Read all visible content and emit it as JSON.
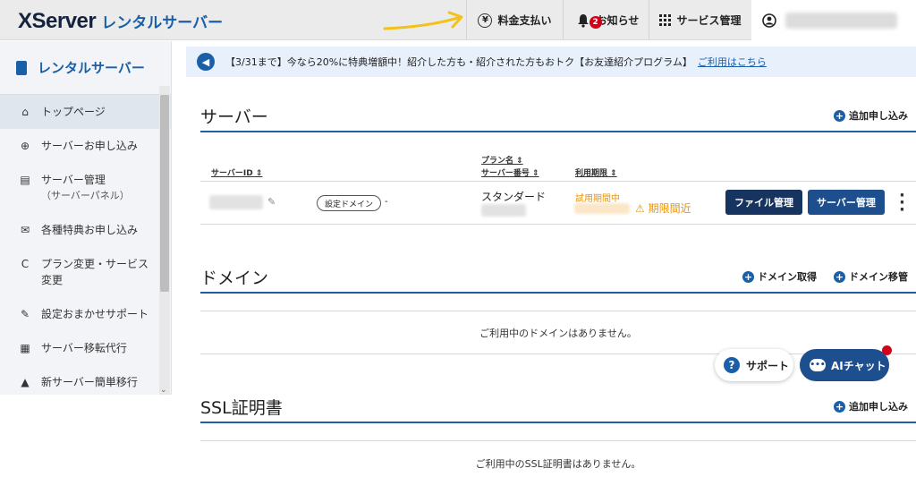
{
  "header": {
    "logo_main": "XServer",
    "logo_sub": "レンタルサーバー",
    "billing_label": "料金支払い",
    "billing_icon": "¥",
    "notifications_label": "お知らせ",
    "notifications_count": "2",
    "services_label": "サービス管理",
    "services_icon": "grid-icon"
  },
  "sidebar": {
    "title": "レンタルサーバー",
    "items": [
      {
        "label": "トップページ",
        "icon": "⌂"
      },
      {
        "label": "サーバーお申し込み",
        "icon": "⊕"
      },
      {
        "label": "サーバー管理",
        "sub": "（サーバーパネル）",
        "icon": "▤"
      },
      {
        "label": "各種特典お申し込み",
        "icon": "✉"
      },
      {
        "label": "プラン変更・サービス",
        "sub": "変更",
        "icon": "C"
      },
      {
        "label": "設定おまかせサポート",
        "icon": "✎"
      },
      {
        "label": "サーバー移転代行",
        "icon": "▦"
      },
      {
        "label": "新サーバー簡単移行",
        "icon": "▲"
      }
    ]
  },
  "banner": {
    "text": "【3/31まで】今なら20%に特典増額中！紹介した方も・紹介された方もおトク【お友達紹介プログラム】",
    "link": "ご利用はこちら"
  },
  "server_section": {
    "title": "サーバー",
    "add_label": "追加申し込み",
    "col_server_id": "サーバーID",
    "col_plan_name": "プラン名",
    "col_server_no": "サーバー番号",
    "col_period": "利用期限",
    "domain_tag": "設定ドメイン",
    "domain_value": "-",
    "plan": "スタンダード",
    "trial_status": "試用期間中",
    "expiry_warning": "期限間近",
    "file_btn": "ファイル管理",
    "server_btn": "サーバー管理"
  },
  "domain_section": {
    "title": "ドメイン",
    "get_label": "ドメイン取得",
    "transfer_label": "ドメイン移管",
    "empty": "ご利用中のドメインはありません。"
  },
  "ssl_section": {
    "title": "SSL証明書",
    "add_label": "追加申し込み",
    "empty": "ご利用中のSSL証明書はありません。"
  },
  "floating": {
    "support_label": "サポート",
    "ai_label": "AIチャット"
  },
  "colors": {
    "brand_navy": "#16345f",
    "accent_blue": "#1a5fa8",
    "warning_orange": "#e8940c",
    "alert_red": "#d0021b"
  }
}
